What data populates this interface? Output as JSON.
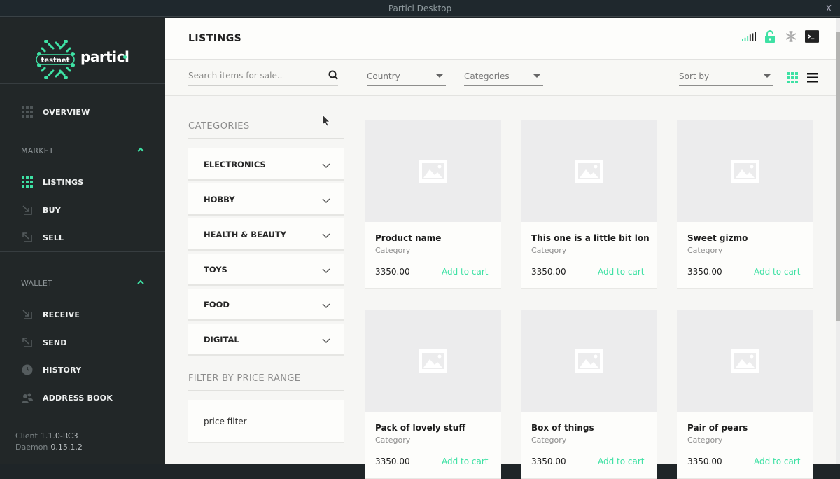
{
  "window": {
    "title": "Particl Desktop",
    "minimize_label": "_",
    "close_label": "X"
  },
  "brand": {
    "name": "particl",
    "network_badge": "testnet",
    "accent_color": "#3ee1a4"
  },
  "sidebar": {
    "overview": {
      "label": "OVERVIEW",
      "icon": "grid-icon"
    },
    "market": {
      "label": "MARKET",
      "expanded": true,
      "items": [
        {
          "label": "LISTINGS",
          "icon": "grid-icon",
          "active": true
        },
        {
          "label": "BUY",
          "icon": "arrow-in-icon",
          "active": false
        },
        {
          "label": "SELL",
          "icon": "arrow-out-icon",
          "active": false
        }
      ]
    },
    "wallet": {
      "label": "WALLET",
      "expanded": true,
      "items": [
        {
          "label": "RECEIVE",
          "icon": "arrow-in-icon"
        },
        {
          "label": "SEND",
          "icon": "arrow-out-icon"
        },
        {
          "label": "HISTORY",
          "icon": "clock-icon"
        },
        {
          "label": "ADDRESS BOOK",
          "icon": "contacts-icon"
        }
      ]
    },
    "version": {
      "client_label": "Client",
      "client_value": "1.1.0-RC3",
      "daemon_label": "Daemon",
      "daemon_value": "0.15.1.2"
    }
  },
  "header": {
    "title": "LISTINGS",
    "status_icons": [
      "signal-icon",
      "unlocked-icon",
      "snowflake-icon",
      "console-icon"
    ]
  },
  "filters": {
    "search_placeholder": "Search items for sale..",
    "search_value": "",
    "country": "Country",
    "categories": "Categories",
    "sort_by": "Sort by",
    "view_mode": "grid"
  },
  "categories_panel": {
    "title": "CATEGORIES",
    "items": [
      "ELECTRONICS",
      "HOBBY",
      "HEALTH & BEAUTY",
      "TOYS",
      "FOOD",
      "DIGITAL"
    ],
    "price_title": "FILTER BY PRICE RANGE",
    "price_filter_label": "price filter"
  },
  "listings": [
    {
      "name": "Product name",
      "category": "Category",
      "price": "3350.00",
      "action": "Add to cart"
    },
    {
      "name": "This one is a little bit longer...",
      "category": "Category",
      "price": "3350.00",
      "action": "Add to cart"
    },
    {
      "name": "Sweet gizmo",
      "category": "Category",
      "price": "3350.00",
      "action": "Add to cart"
    },
    {
      "name": "Pack of lovely stuff",
      "category": "Category",
      "price": "3350.00",
      "action": "Add to cart"
    },
    {
      "name": "Box of things",
      "category": "Category",
      "price": "3350.00",
      "action": "Add to cart"
    },
    {
      "name": "Pair of pears",
      "category": "Category",
      "price": "3350.00",
      "action": "Add to cart"
    }
  ]
}
